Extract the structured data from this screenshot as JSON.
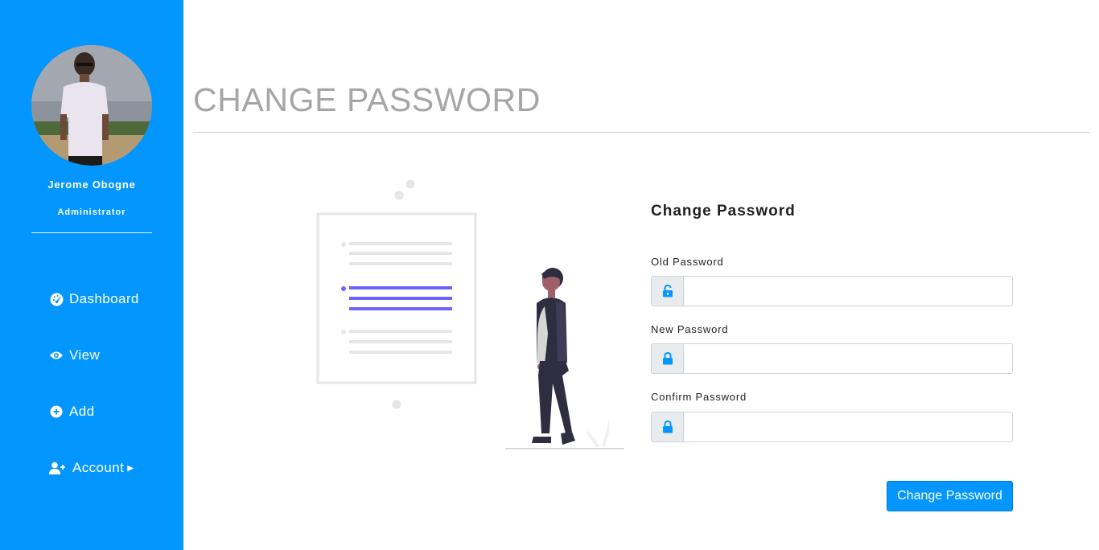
{
  "sidebar": {
    "user_name": "Jerome Obogne",
    "user_role": "Administrator",
    "nav": [
      {
        "label": "Dashboard",
        "icon": "dashboard-icon"
      },
      {
        "label": "View",
        "icon": "eye-icon"
      },
      {
        "label": "Add",
        "icon": "plus-circle-icon"
      },
      {
        "label": "Account",
        "icon": "user-plus-icon",
        "has_submenu": true
      }
    ]
  },
  "main": {
    "page_title": "CHANGE PASSWORD",
    "form": {
      "heading": "Change Password",
      "fields": [
        {
          "label": "Old Password",
          "value": "",
          "icon": "unlock-icon"
        },
        {
          "label": "New Password",
          "value": "",
          "icon": "lock-icon"
        },
        {
          "label": "Confirm Password",
          "value": "",
          "icon": "lock-icon"
        }
      ],
      "submit_label": "Change Password"
    }
  },
  "colors": {
    "sidebar_bg": "#0396ff",
    "accent": "#0396ff",
    "title_gray": "#a6a6a6",
    "illustration_accent": "#6c63ff"
  }
}
